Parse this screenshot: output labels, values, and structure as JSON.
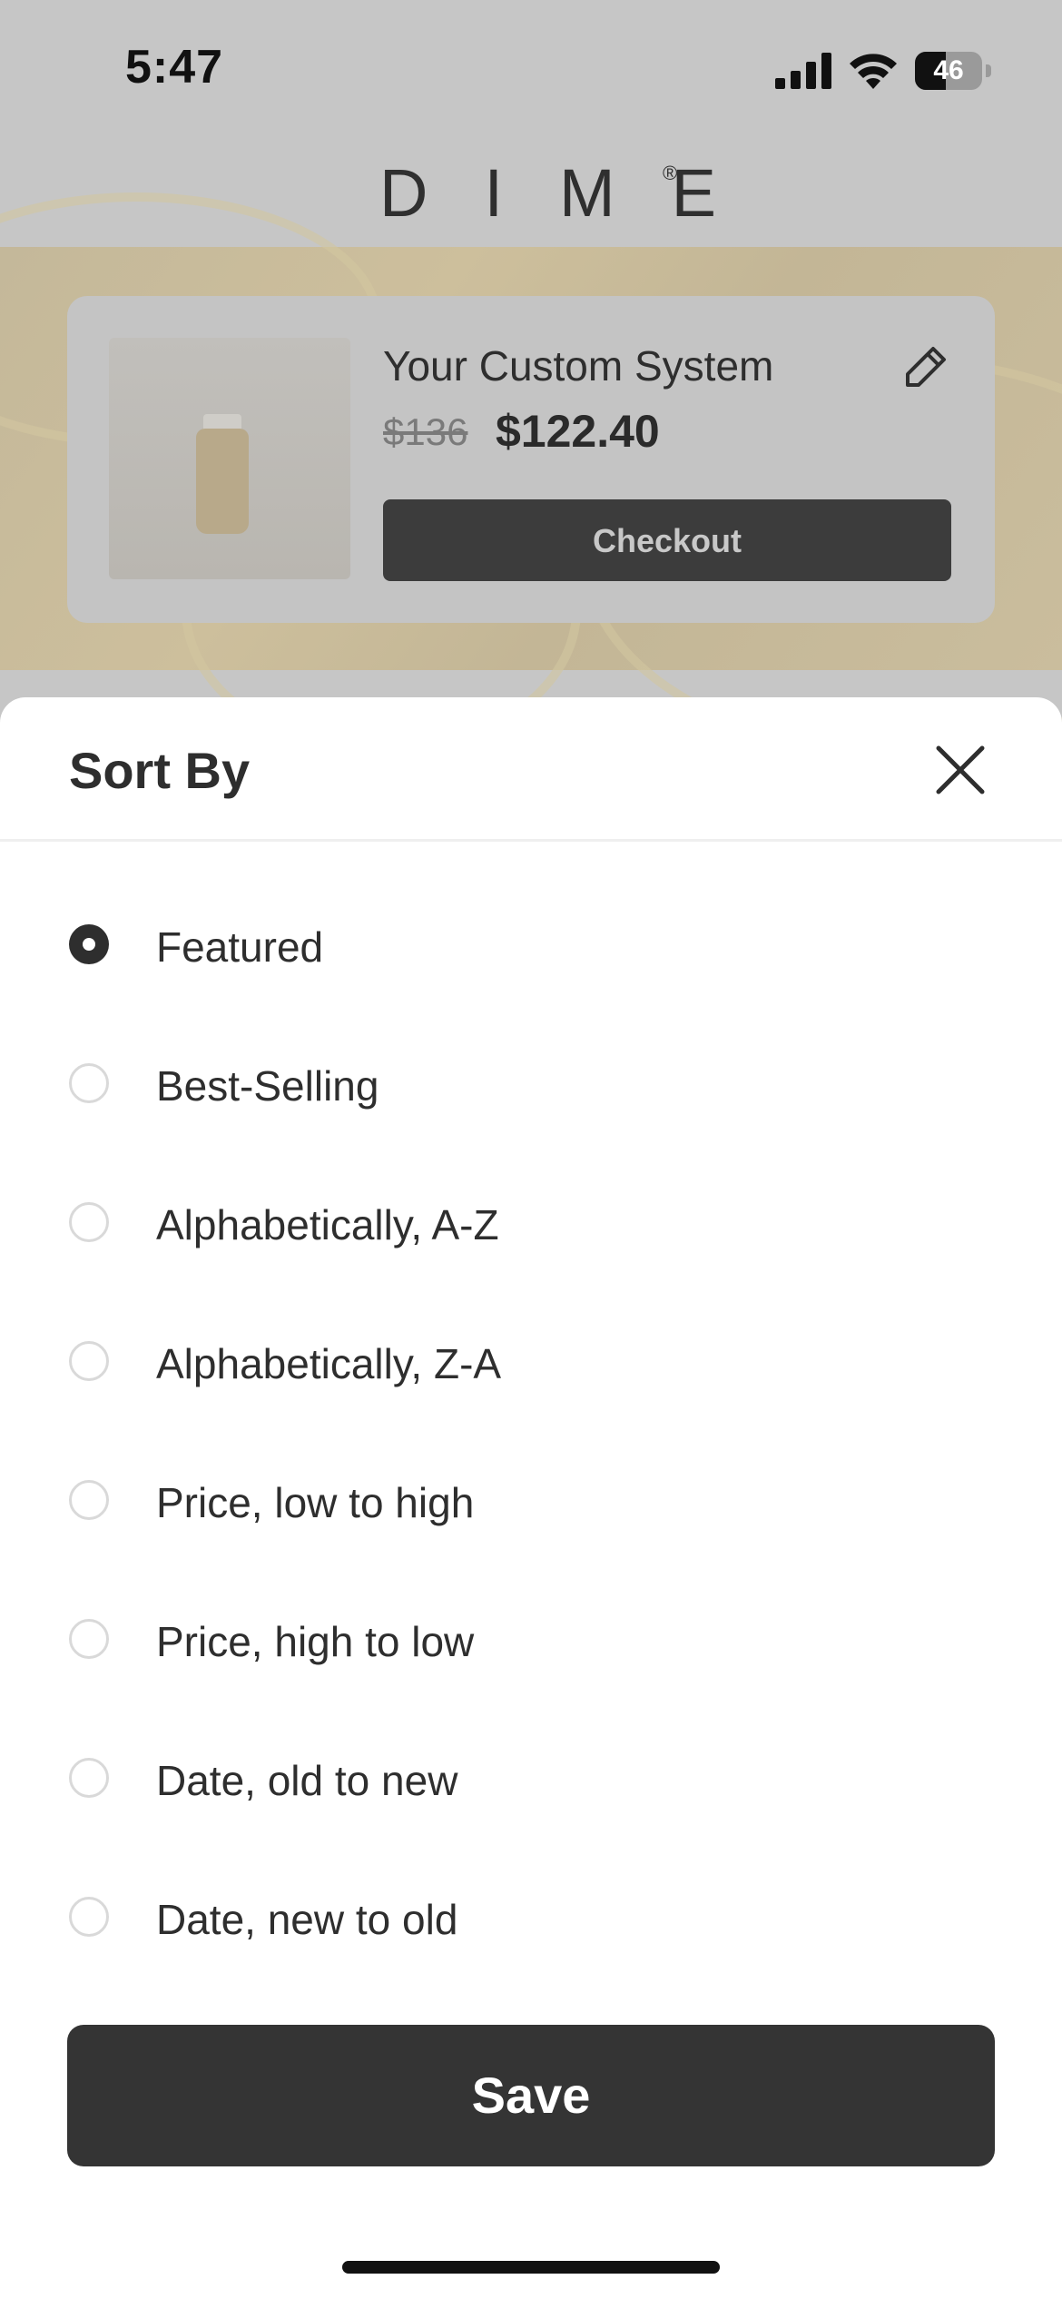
{
  "status_bar": {
    "time": "5:47",
    "battery_level": "46",
    "battery_fraction": 0.46
  },
  "brand": {
    "logo": "DIME",
    "registered": "®"
  },
  "cart_card": {
    "title": "Your Custom System",
    "original_price": "$136",
    "price": "$122.40",
    "checkout_label": "Checkout"
  },
  "sort_sheet": {
    "title": "Sort By",
    "selected_index": 0,
    "options": [
      {
        "label": "Featured"
      },
      {
        "label": "Best-Selling"
      },
      {
        "label": "Alphabetically, A-Z"
      },
      {
        "label": "Alphabetically, Z-A"
      },
      {
        "label": "Price, low to high"
      },
      {
        "label": "Price, high to low"
      },
      {
        "label": "Date, old to new"
      },
      {
        "label": "Date, new to old"
      }
    ],
    "save_label": "Save"
  },
  "colors": {
    "overlay": "#c6c6c6",
    "dark_button": "#343434",
    "text": "#2e2e2e",
    "radio_border": "#d9d9d9"
  }
}
